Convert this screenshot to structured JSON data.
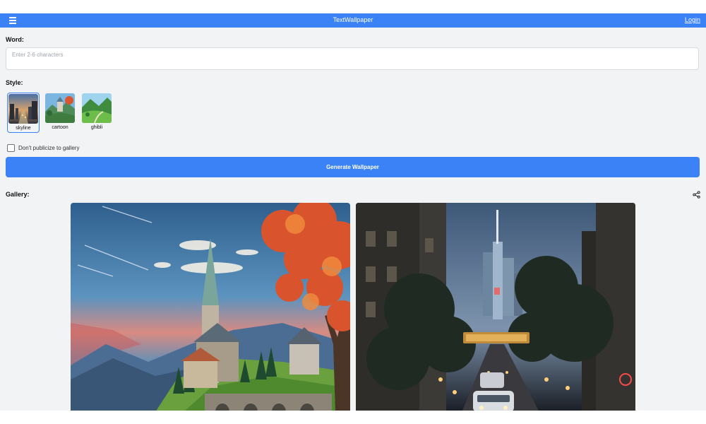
{
  "header": {
    "title": "TextWallpaper",
    "login_label": "Login",
    "menu_icon": "hamburger-menu-icon"
  },
  "word": {
    "label": "Word:",
    "placeholder": "Enter 2-6 characters",
    "value": ""
  },
  "style": {
    "label": "Style:",
    "selected": "skyline",
    "options": [
      {
        "name": "skyline"
      },
      {
        "name": "cartoon"
      },
      {
        "name": "ghibli"
      }
    ]
  },
  "privacy": {
    "label": "Don't publicize to gallery",
    "checked": false
  },
  "generate": {
    "label": "Generate Wallpaper"
  },
  "gallery": {
    "label": "Gallery:",
    "share_icon": "share-icon",
    "items": [
      {
        "alt": "anime castle landscape with autumn tree"
      },
      {
        "alt": "city street at night with skyscraper"
      }
    ]
  },
  "colors": {
    "accent": "#3b82f6",
    "background": "#f2f3f5"
  }
}
